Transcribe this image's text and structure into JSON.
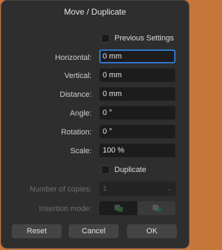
{
  "dialog": {
    "title": "Move / Duplicate",
    "previous_settings_label": "Previous Settings",
    "fields": {
      "horizontal": {
        "label": "Horizontal:",
        "value": "0 mm"
      },
      "vertical": {
        "label": "Vertical:",
        "value": "0 mm"
      },
      "distance": {
        "label": "Distance:",
        "value": "0 mm"
      },
      "angle": {
        "label": "Angle:",
        "value": "0 °"
      },
      "rotation": {
        "label": "Rotation:",
        "value": "0 °"
      },
      "scale": {
        "label": "Scale:",
        "value": "100 %"
      }
    },
    "duplicate_label": "Duplicate",
    "copies": {
      "label": "Number of copies:",
      "value": "1"
    },
    "insertion": {
      "label": "Insertion mode:"
    },
    "buttons": {
      "reset": "Reset",
      "cancel": "Cancel",
      "ok": "OK"
    }
  }
}
